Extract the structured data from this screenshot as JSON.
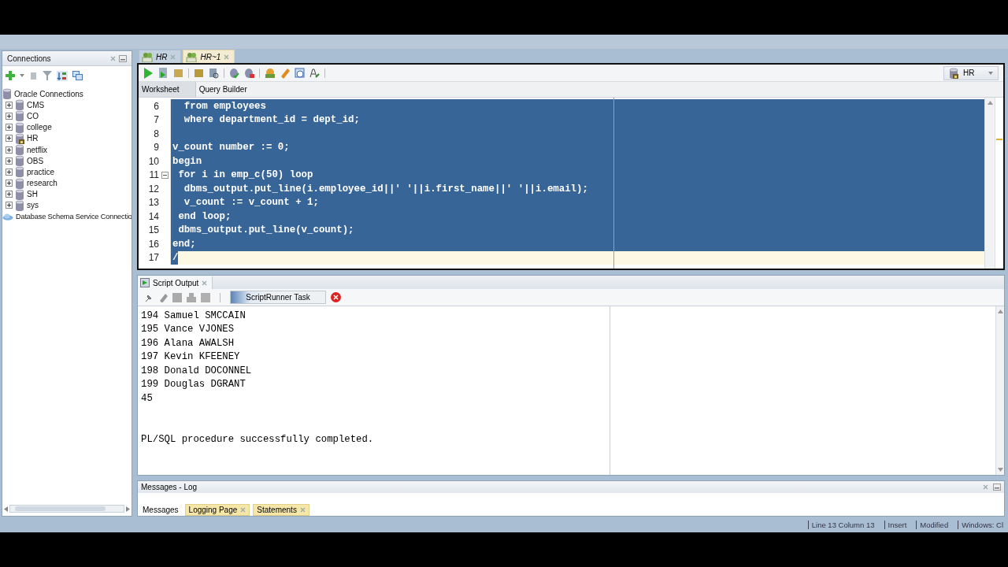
{
  "connections": {
    "title": "Connections",
    "root": {
      "label": "Oracle Connections",
      "children": [
        {
          "label": "CMS",
          "expanded": false,
          "connected": false
        },
        {
          "label": "CO",
          "expanded": false,
          "connected": false
        },
        {
          "label": "college",
          "expanded": false,
          "connected": false
        },
        {
          "label": "HR",
          "expanded": false,
          "connected": true
        },
        {
          "label": "netflix",
          "expanded": false,
          "connected": false
        },
        {
          "label": "OBS",
          "expanded": false,
          "connected": false
        },
        {
          "label": "practice",
          "expanded": false,
          "connected": false
        },
        {
          "label": "research",
          "expanded": false,
          "connected": false
        },
        {
          "label": "SH",
          "expanded": false,
          "connected": false
        },
        {
          "label": "sys",
          "expanded": false,
          "connected": false
        }
      ]
    },
    "cloud": {
      "label": "Database Schema Service Connectio"
    }
  },
  "editor": {
    "tabs": [
      {
        "label": "HR",
        "selected": false
      },
      {
        "label": "HR~1",
        "selected": true
      }
    ],
    "connection": "HR",
    "subtabs": [
      {
        "label": "Worksheet",
        "selected": true
      },
      {
        "label": "Query Builder",
        "selected": false
      }
    ],
    "lines": [
      {
        "number": "6",
        "text": "  from employees",
        "selected": true,
        "current": false,
        "fold": false
      },
      {
        "number": "7",
        "text": "  where department_id = dept_id;",
        "selected": true,
        "current": false,
        "fold": false
      },
      {
        "number": "8",
        "selected": true,
        "current": false,
        "fold": false
      },
      {
        "number": "9",
        "text": "v_count number := 0;",
        "selected": true,
        "current": false,
        "fold": false
      },
      {
        "number": "10",
        "text": "begin",
        "selected": true,
        "current": false,
        "fold": false
      },
      {
        "number": "11",
        "text": " for i in emp_c(50) loop",
        "selected": true,
        "current": false,
        "fold": true
      },
      {
        "number": "12",
        "text": "  dbms_output.put_line(i.employee_id||' '||i.first_name||' '||i.email);",
        "selected": true,
        "current": false,
        "fold": false
      },
      {
        "number": "13",
        "text": "  v_count := v_count + 1;",
        "selected": true,
        "current": false,
        "fold": false
      },
      {
        "number": "14",
        "text": " end loop;",
        "selected": true,
        "current": false,
        "fold": false
      },
      {
        "number": "15",
        "text": " dbms_output.put_line(v_count);",
        "selected": true,
        "current": false,
        "fold": false
      },
      {
        "number": "16",
        "text": "end;",
        "selected": true,
        "current": false,
        "fold": false
      },
      {
        "number": "17",
        "text": "/",
        "selected": true,
        "current": true,
        "fold": false
      }
    ]
  },
  "output": {
    "tab": "Script Output",
    "task": "ScriptRunner Task",
    "level": 0.2,
    "lines": [
      "194 Samuel SMCCAIN",
      "195 Vance VJONES",
      "196 Alana AWALSH",
      "197 Kevin KFEENEY",
      "198 Donald DOCONNEL",
      "199 Douglas DGRANT",
      "45"
    ],
    "result": "PL/SQL procedure successfully completed."
  },
  "log": {
    "title": "Messages - Log",
    "tabs": [
      {
        "label": "Messages",
        "selected": true
      },
      {
        "label": "Logging Page",
        "selected": false
      },
      {
        "label": "Statements",
        "selected": false
      }
    ]
  },
  "status_bar": [
    "Line 13 Column 13",
    "Insert",
    "Modified",
    "Windows: Cl"
  ]
}
